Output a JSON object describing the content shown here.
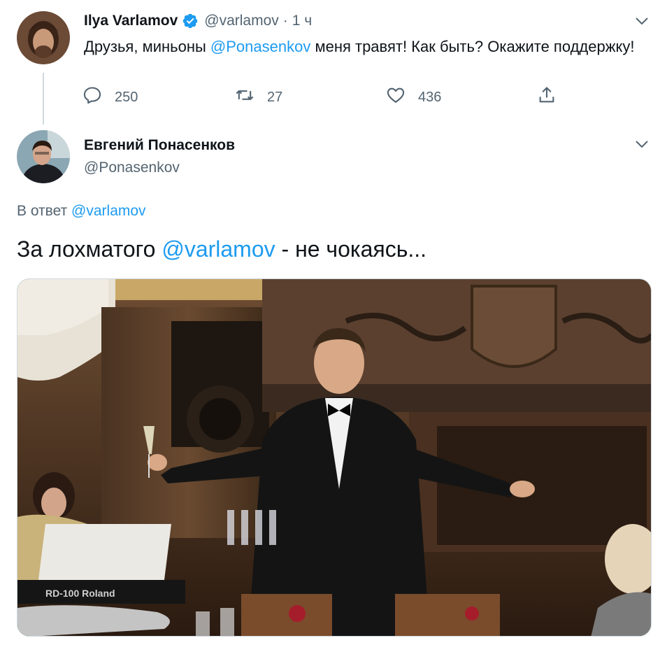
{
  "tweet1": {
    "author_name": "Ilya Varlamov",
    "handle": "@varlamov",
    "separator": "·",
    "time": "1 ч",
    "text_before": "Друзья, миньоны ",
    "mention": "@Ponasenkov",
    "text_after": "  меня травят! Как быть? Окажите поддержку!",
    "replies": "250",
    "retweets": "27",
    "likes": "436"
  },
  "tweet2": {
    "author_name": "Евгений Понасенков",
    "handle": "@Ponasenkov",
    "reply_prefix": "В ответ ",
    "reply_mention": "@varlamov",
    "text_before": "За лохматого ",
    "mention": "@varlamov",
    "text_after": "  - не чокаясь...",
    "photo_label": "RD-100 Roland"
  },
  "colors": {
    "accent": "#1d9bf0",
    "secondary_text": "#536471",
    "verified": "#1d9bf0"
  },
  "icons": [
    "chevron-down-icon",
    "verified-badge-icon",
    "reply-icon",
    "retweet-icon",
    "like-icon",
    "share-icon"
  ]
}
